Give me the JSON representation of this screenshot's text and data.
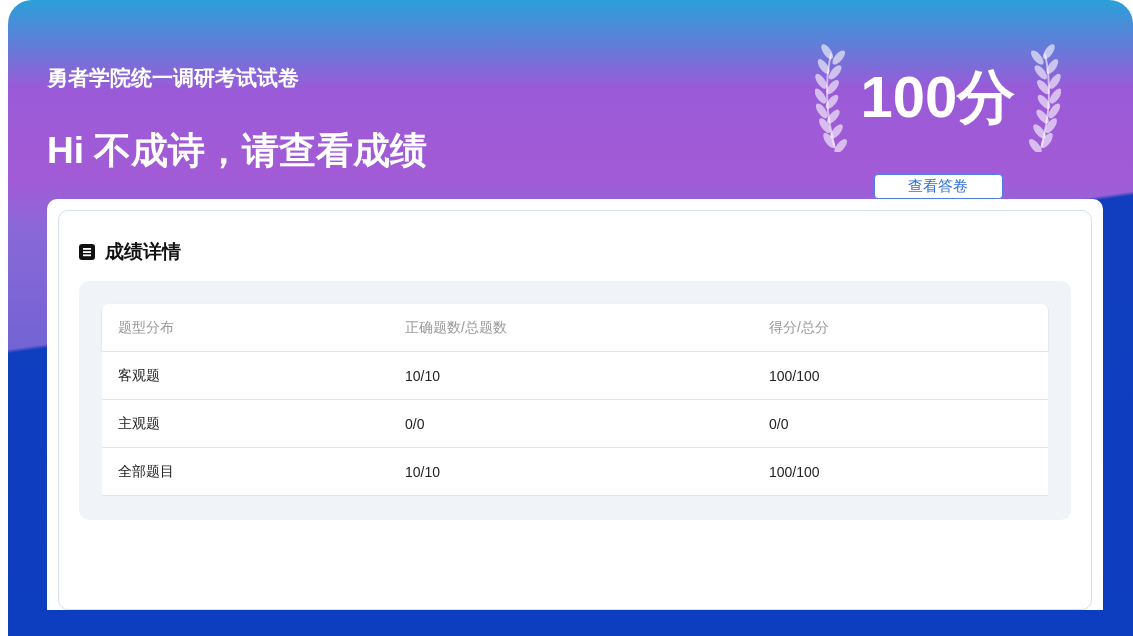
{
  "header": {
    "exam_title": "勇者学院统一调研考试试卷",
    "greeting": "Hi 不成诗，请查看成绩",
    "score": "100分",
    "view_answers_button": "查看答卷"
  },
  "details": {
    "title": "成绩详情",
    "table": {
      "columns": [
        "题型分布",
        "正确题数/总题数",
        "得分/总分"
      ],
      "rows": [
        {
          "cells": [
            "客观题",
            "10/10",
            "100/100"
          ]
        },
        {
          "cells": [
            "主观题",
            "0/0",
            "0/0"
          ]
        },
        {
          "cells": [
            "全部题目",
            "10/10",
            "100/100"
          ]
        }
      ]
    }
  }
}
